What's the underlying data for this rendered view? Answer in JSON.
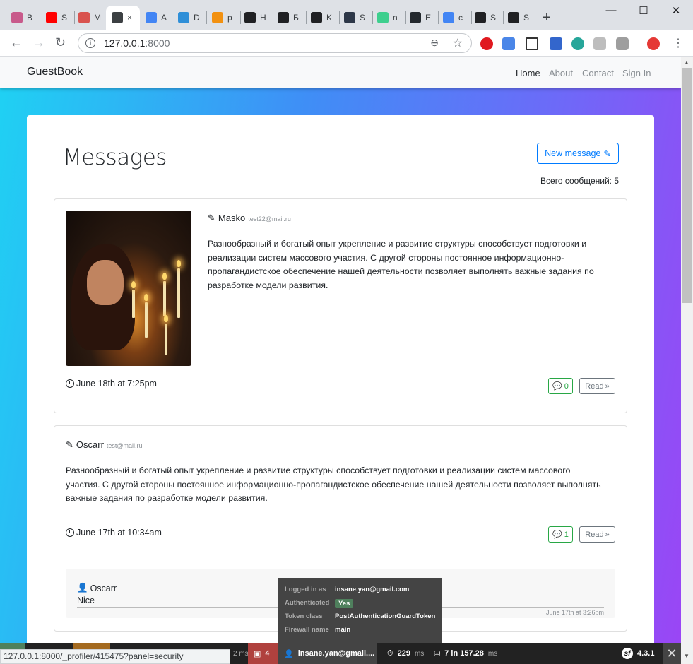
{
  "browser": {
    "tabs": [
      {
        "title": "B",
        "color": "#c85a8b"
      },
      {
        "title": "S",
        "color": "#ff0000"
      },
      {
        "title": "M",
        "color": "#d9534f"
      },
      {
        "title": "×",
        "color": "#3c4043"
      },
      {
        "title": "A",
        "color": "#4285f4"
      },
      {
        "title": "D",
        "color": "#2f8fd8"
      },
      {
        "title": "p",
        "color": "#f29111"
      },
      {
        "title": "H",
        "color": "#202124"
      },
      {
        "title": "Б",
        "color": "#202124"
      },
      {
        "title": "K",
        "color": "#202124"
      },
      {
        "title": "S",
        "color": "#2d3748"
      },
      {
        "title": "n",
        "color": "#3ecf8e"
      },
      {
        "title": "E",
        "color": "#24292e"
      },
      {
        "title": "c",
        "color": "#4285f4"
      },
      {
        "title": "S",
        "color": "#202124"
      },
      {
        "title": "S",
        "color": "#202124"
      }
    ],
    "new_tab": "+",
    "win_minimize": "—",
    "win_maximize": "☐",
    "win_close": "✕",
    "back": "←",
    "forward": "→",
    "reload": "↻",
    "url_host": "127.0.0.1",
    "url_port": ":8000",
    "zoom_icon": "⊖",
    "star_icon": "☆",
    "menu": "⋮"
  },
  "navbar": {
    "brand": "GuestBook",
    "links": [
      "Home",
      "About",
      "Contact",
      "Sign In"
    ]
  },
  "main": {
    "title": "Messages",
    "new_message": "New message",
    "total": "Всего сообщений: 5"
  },
  "messages": [
    {
      "author": "Masko",
      "email": "test22@mail.ru",
      "text": "Разнообразный и богатый опыт укрепление и развитие структуры способствует подготовки и реализации систем массового участия. С другой стороны постоянное информационно-пропагандистское обеспечение нашей деятельности позволяет выполнять важные задания по разработке модели развития.",
      "date": "June 18th at 7:25pm",
      "comments": "0",
      "read": "Read"
    },
    {
      "author": "Oscarr",
      "email": "test@mail.ru",
      "text": "Разнообразный и богатый опыт укрепление и развитие структуры способствует подготовки и реализации систем массового участия. С другой стороны постоянное информационно-пропагандистское обеспечение нашей деятельности позволяет выполнять важные задания по разработке модели развития.",
      "date": "June 17th at 10:34am",
      "comments": "1",
      "read": "Read",
      "comment": {
        "author": "Oscarr",
        "text": "Nice",
        "date": "June 17th at 3:26pm"
      }
    }
  ],
  "symfony": {
    "status_url": "127.0.0.1:8000/_profiler/415475?panel=security",
    "time_fragment": "2 ms",
    "errors": "4",
    "user": "insane.yan@gmail....",
    "time": "229",
    "time_unit": "ms",
    "db": "7 in 157.28",
    "db_unit": "ms",
    "version": "4.3.1",
    "popup": {
      "logged_in_label": "Logged in as",
      "logged_in_value": "insane.yan@gmail.com",
      "auth_label": "Authenticated",
      "auth_value": "Yes",
      "token_label": "Token class",
      "token_value": "PostAuthenticationGuardToken",
      "firewall_label": "Firewall name",
      "firewall_value": "main"
    }
  }
}
